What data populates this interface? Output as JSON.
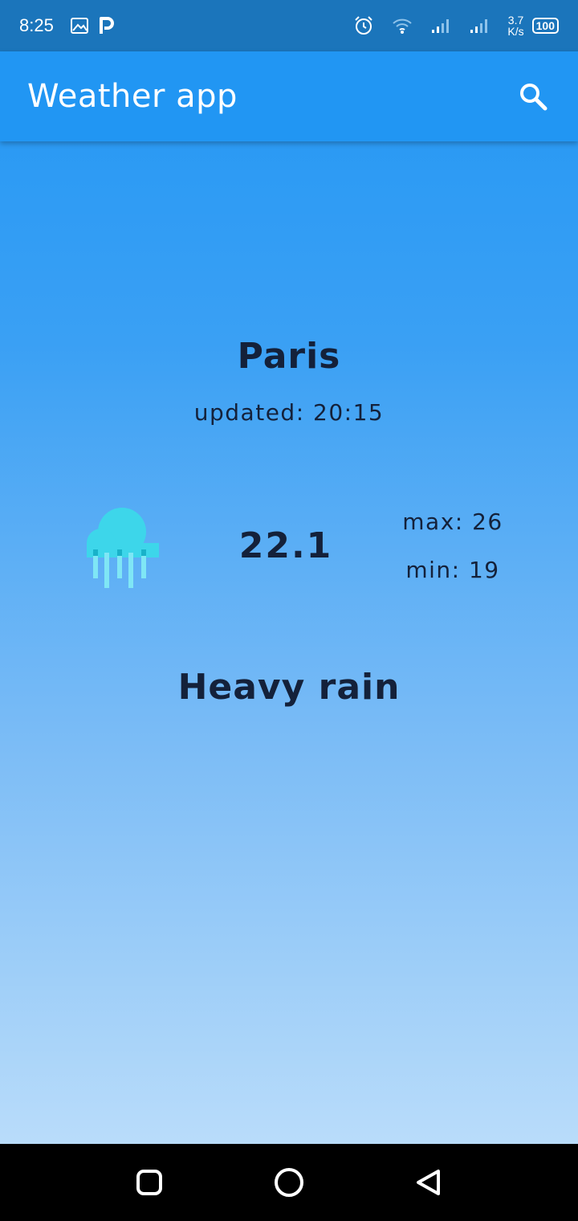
{
  "status_bar": {
    "time": "8:25",
    "net_speed_value": "3.7",
    "net_speed_unit": "K/s",
    "battery": "100",
    "icons": [
      "image-icon",
      "p-app-icon",
      "alarm-icon",
      "wifi-icon",
      "signal-icon",
      "signal-icon"
    ]
  },
  "app_bar": {
    "title": "Weather app",
    "search_icon": "search-icon"
  },
  "weather": {
    "city": "Paris",
    "updated": "updated: 20:15",
    "temperature": "22.1",
    "max": "max: 26",
    "min": "min: 19",
    "condition": "Heavy rain",
    "icon": "heavy-rain-icon"
  },
  "nav_bar": {
    "buttons": [
      "recents-button",
      "home-button",
      "back-button"
    ]
  },
  "colors": {
    "status_bar": "#1b75bb",
    "app_bar": "#2196f3",
    "text": "#14213a",
    "cloud": "#3dd6ea",
    "rain": "#7fe6f5"
  }
}
